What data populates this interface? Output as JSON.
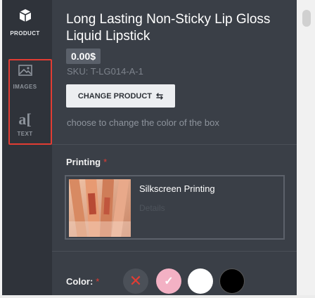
{
  "sidebar": {
    "product_label": "PRODUCT",
    "images_label": "IMAGES",
    "text_label": "TEXT",
    "text_glyph": "a[",
    "icons": {
      "product": "box-icon",
      "images": "image-icon",
      "text": "text-icon"
    }
  },
  "product": {
    "title": "Long Lasting Non-Sticky Lip Gloss Liquid Lipstick",
    "price": "0.00$",
    "sku": "SKU: T-LG014-A-1",
    "change_button": "CHANGE PRODUCT",
    "hint": "choose to change the color of the box"
  },
  "printing": {
    "label": "Printing",
    "required_mark": "*",
    "option_name": "Silkscreen Printing",
    "details_link": "Details"
  },
  "color": {
    "label": "Color:",
    "required_mark": "*",
    "swatches": [
      {
        "name": "none",
        "hex": "#4b5058"
      },
      {
        "name": "pink",
        "hex": "#f3b1c4",
        "selected": true
      },
      {
        "name": "white",
        "hex": "#ffffff"
      },
      {
        "name": "black",
        "hex": "#000000"
      }
    ]
  },
  "colors": {
    "sidebar_bg": "#2f333a",
    "panel_bg": "#3a3f47",
    "accent_red": "#e23c33"
  }
}
